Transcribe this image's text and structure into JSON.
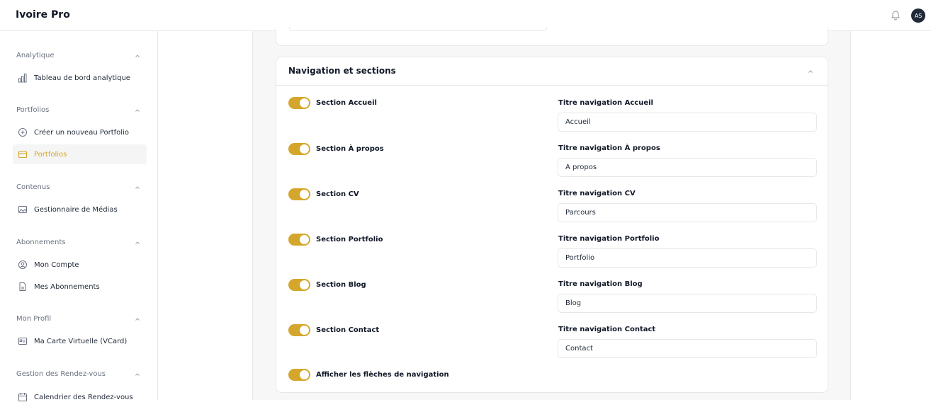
{
  "header": {
    "brand": "Ivoire Pro",
    "avatar_initials": "AS",
    "bell_icon": "bell-icon"
  },
  "sidebar": {
    "groups": [
      {
        "title": "Analytique",
        "items": [
          {
            "label": "Tableau de bord analytique",
            "icon": "bar-chart-icon"
          }
        ]
      },
      {
        "title": "Portfolios",
        "items": [
          {
            "label": "Créer un nouveau Portfolio",
            "icon": "plus-circle-icon"
          },
          {
            "label": "Portfolios",
            "icon": "folder-icon",
            "active": true
          }
        ]
      },
      {
        "title": "Contenus",
        "items": [
          {
            "label": "Gestionnaire de Médias",
            "icon": "image-icon"
          }
        ]
      },
      {
        "title": "Abonnements",
        "items": [
          {
            "label": "Mon Compte",
            "icon": "user-circle-icon"
          },
          {
            "label": "Mes Abonnements",
            "icon": "document-icon"
          }
        ]
      },
      {
        "title": "Mon Profil",
        "items": [
          {
            "label": "Ma Carte Virtuelle (VCard)",
            "icon": "id-card-icon"
          }
        ]
      },
      {
        "title": "Gestion des Rendez-vous",
        "items": [
          {
            "label": "Calendrier des Rendez-vous",
            "icon": "calendar-icon"
          }
        ]
      }
    ]
  },
  "main": {
    "section_title": "Navigation et sections",
    "sections": [
      {
        "toggle_label": "Section Accueil",
        "enabled": true,
        "field_label": "Titre navigation Accueil",
        "value": "Accueil"
      },
      {
        "toggle_label": "Section À propos",
        "enabled": true,
        "field_label": "Titre navigation À propos",
        "value": "À propos"
      },
      {
        "toggle_label": "Section CV",
        "enabled": true,
        "field_label": "Titre navigation CV",
        "value": "Parcours"
      },
      {
        "toggle_label": "Section Portfolio",
        "enabled": true,
        "field_label": "Titre navigation Portfolio",
        "value": "Portfolio"
      },
      {
        "toggle_label": "Section Blog",
        "enabled": true,
        "field_label": "Titre navigation Blog",
        "value": "Blog"
      },
      {
        "toggle_label": "Section Contact",
        "enabled": true,
        "field_label": "Titre navigation Contact",
        "value": "Contact"
      }
    ],
    "arrows_toggle": {
      "label": "Afficher les flèches de navigation",
      "enabled": true
    }
  },
  "colors": {
    "accent": "#d4a72c",
    "border": "#e5e7eb",
    "content_bg": "#f7f7f7"
  }
}
